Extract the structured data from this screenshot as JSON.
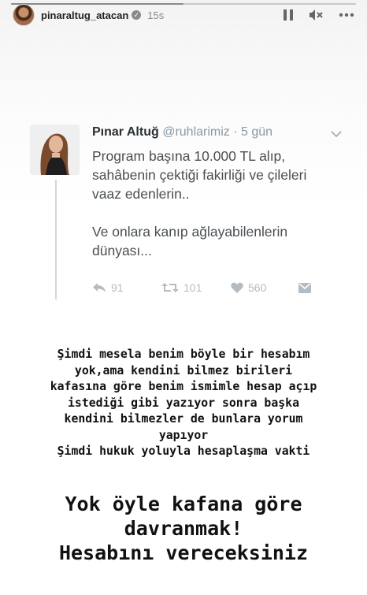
{
  "story": {
    "progress": 0.5,
    "username": "pinaraltug_atacan",
    "time_ago": "15s"
  },
  "icons": {
    "pause": "pause-icon",
    "mute": "mute-icon",
    "more": "more-icon",
    "verified": "verified-badge-icon"
  },
  "tweet": {
    "name": "Pınar Altuğ",
    "handle": "@ruhlarimiz",
    "separator": "·",
    "time": "5 gün",
    "body": "Program başına 10.000 TL alıp,\nsahâbenin çektiği fakirliği ve çileleri\nvaaz edenlerin..\n\nVe onlara kanıp ağlayabilenlerin\ndünyası...",
    "replies": "91",
    "retweets": "101",
    "likes": "560"
  },
  "note": {
    "lines": [
      "Şimdi mesela benim böyle bir hesabım",
      "yok,ama kendini bilmez birileri",
      "kafasına göre benim ismimle hesap açıp",
      "istediği gibi yazıyor sonra başka",
      "kendini bilmezler de bunlara yorum",
      "yapıyor",
      "Şimdi hukuk yoluyla hesaplaşma vakti"
    ],
    "big_lines": [
      "Yok öyle kafana göre",
      "davranmak!",
      "Hesabını vereceksiniz"
    ]
  },
  "colors": {
    "tweet_text": "#4a4f53",
    "tweet_meta": "#8899a6"
  }
}
